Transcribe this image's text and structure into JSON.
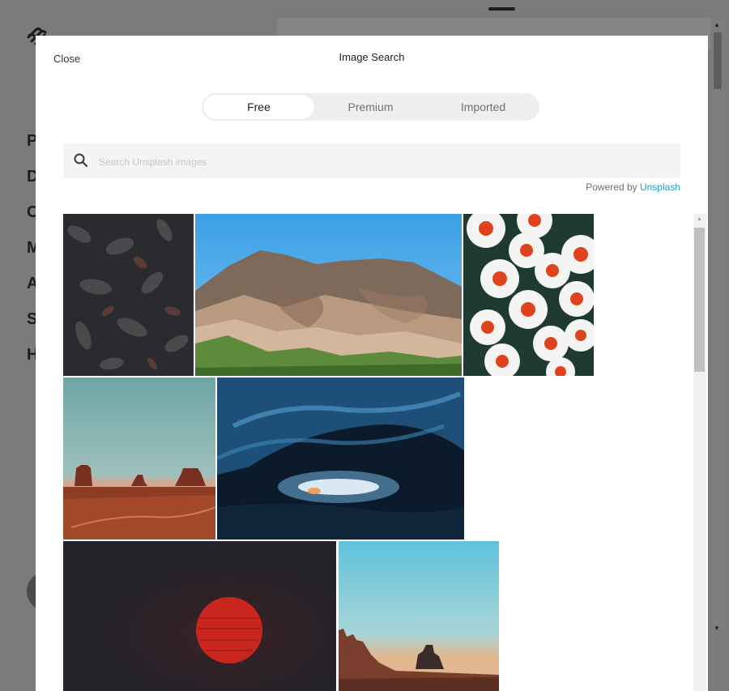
{
  "background": {
    "nav_items": [
      "P",
      "D",
      "C",
      "M",
      "A",
      "S",
      "H"
    ]
  },
  "modal": {
    "close_label": "Close",
    "title": "Image Search",
    "tabs": [
      {
        "label": "Free",
        "active": true
      },
      {
        "label": "Premium",
        "active": false
      },
      {
        "label": "Imported",
        "active": false
      }
    ],
    "search": {
      "placeholder": "Search Unsplash images",
      "value": ""
    },
    "powered_by_prefix": "Powered by",
    "powered_by_link": "Unsplash",
    "accent_color": "#1a9fcc"
  },
  "results": [
    {
      "subject": "dark dried leaves"
    },
    {
      "subject": "rainbow mountains with blue sky"
    },
    {
      "subject": "white daisies with red centers"
    },
    {
      "subject": "desert buttes at dusk"
    },
    {
      "subject": "blue ice cave"
    },
    {
      "subject": "red sun on dark sky"
    },
    {
      "subject": "desert butte under turquoise sky"
    }
  ],
  "icons": {
    "search": "search-icon",
    "logo": "squarespace-logo-icon"
  }
}
